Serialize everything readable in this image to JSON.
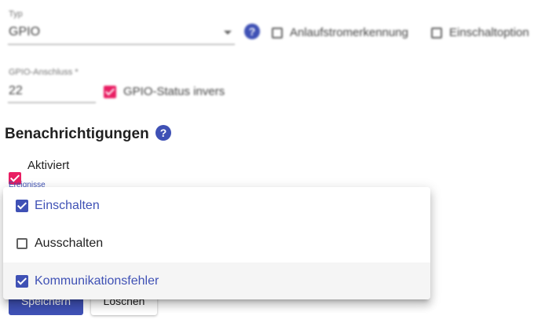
{
  "form": {
    "type": {
      "label": "Typ",
      "value": "GPIO"
    },
    "startup_current_detection": {
      "label": "Anlaufstromerkennung",
      "checked": false
    },
    "switch_on_option": {
      "label": "Einschaltoption",
      "checked": false
    },
    "gpio_pin": {
      "label": "GPIO-Anschluss *",
      "value": "22"
    },
    "gpio_status_inverted": {
      "label": "GPIO-Status invers",
      "checked": true
    }
  },
  "notifications": {
    "title": "Benachrichtigungen",
    "enabled": {
      "label": "Aktiviert",
      "checked": true
    },
    "events_label": "Ereignisse"
  },
  "events_menu": {
    "items": [
      {
        "label": "Einschalten",
        "checked": true
      },
      {
        "label": "Ausschalten",
        "checked": false
      },
      {
        "label": "Kommunikationsfehler",
        "checked": true
      }
    ]
  },
  "actions": {
    "save_label": "Speichern",
    "delete_label": "Löschen"
  },
  "colors": {
    "primary": "#3f51b5",
    "accent": "#e91e63"
  },
  "icons": {
    "help": "help-circle-icon",
    "dropdown": "chevron-down-icon"
  }
}
